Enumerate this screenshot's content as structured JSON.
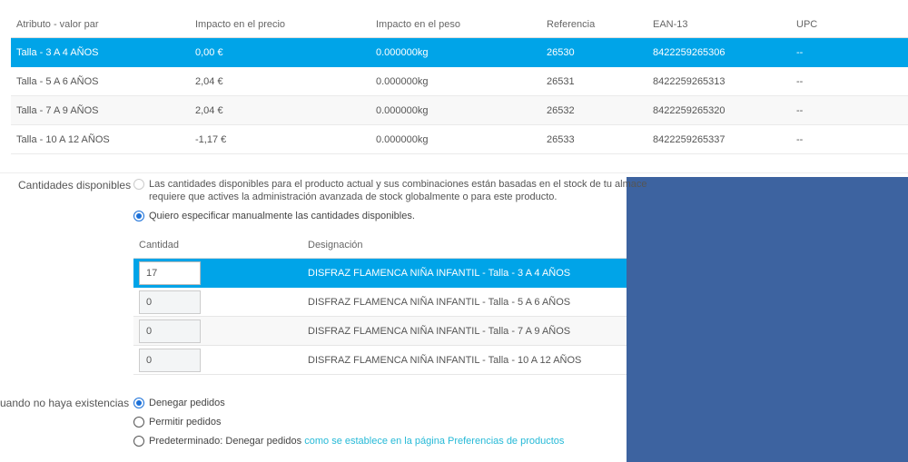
{
  "combinations": {
    "headers": [
      "Atributo - valor par",
      "Impacto en el precio",
      "Impacto en el peso",
      "Referencia",
      "EAN-13",
      "UPC"
    ],
    "rows": [
      {
        "attr": "Talla - 3 A 4 AÑOS",
        "price": "0,00 €",
        "weight": "0.000000kg",
        "ref": "26530",
        "ean": "8422259265306",
        "upc": "--"
      },
      {
        "attr": "Talla - 5 A 6 AÑOS",
        "price": "2,04 €",
        "weight": "0.000000kg",
        "ref": "26531",
        "ean": "8422259265313",
        "upc": "--"
      },
      {
        "attr": "Talla - 7 A 9 AÑOS",
        "price": "2,04 €",
        "weight": "0.000000kg",
        "ref": "26532",
        "ean": "8422259265320",
        "upc": "--"
      },
      {
        "attr": "Talla - 10 A 12 AÑOS",
        "price": "-1,17 €",
        "weight": "0.000000kg",
        "ref": "26533",
        "ean": "8422259265337",
        "upc": "--"
      }
    ],
    "selected_row": 0
  },
  "available_quantities": {
    "label": "Cantidades disponibles",
    "option_stock_line1": "Las cantidades disponibles para el producto actual y sus combinaciones están basadas en el stock de tu almace",
    "option_stock_line2": "requiere que actives la administración avanzada de stock globalmente o para este producto.",
    "option_manual": "Quiero especificar manualmente las cantidades disponibles.",
    "selected_option": "manual",
    "table": {
      "headers": [
        "Cantidad",
        "Designación"
      ],
      "rows": [
        {
          "qty": "17",
          "designation": "DISFRAZ FLAMENCA NIÑA INFANTIL - Talla - 3 A 4 AÑOS"
        },
        {
          "qty": "0",
          "designation": "DISFRAZ FLAMENCA NIÑA INFANTIL - Talla - 5 A 6 AÑOS"
        },
        {
          "qty": "0",
          "designation": "DISFRAZ FLAMENCA NIÑA INFANTIL - Talla - 7 A 9 AÑOS"
        },
        {
          "qty": "0",
          "designation": "DISFRAZ FLAMENCA NIÑA INFANTIL - Talla - 10 A 12 AÑOS"
        }
      ]
    }
  },
  "out_of_stock": {
    "label": "uando no haya existencias",
    "options": {
      "deny": "Denegar pedidos",
      "allow": "Permitir pedidos",
      "default_prefix": "Predeterminado: Denegar pedidos",
      "default_link": "como se establece en la página Preferencias de productos"
    },
    "selected_option": "deny"
  },
  "colors": {
    "accent": "#00a4e8",
    "radio_checked": "#1a70d8",
    "link": "#25b9d7",
    "blue_panel": "#3d63a0"
  }
}
